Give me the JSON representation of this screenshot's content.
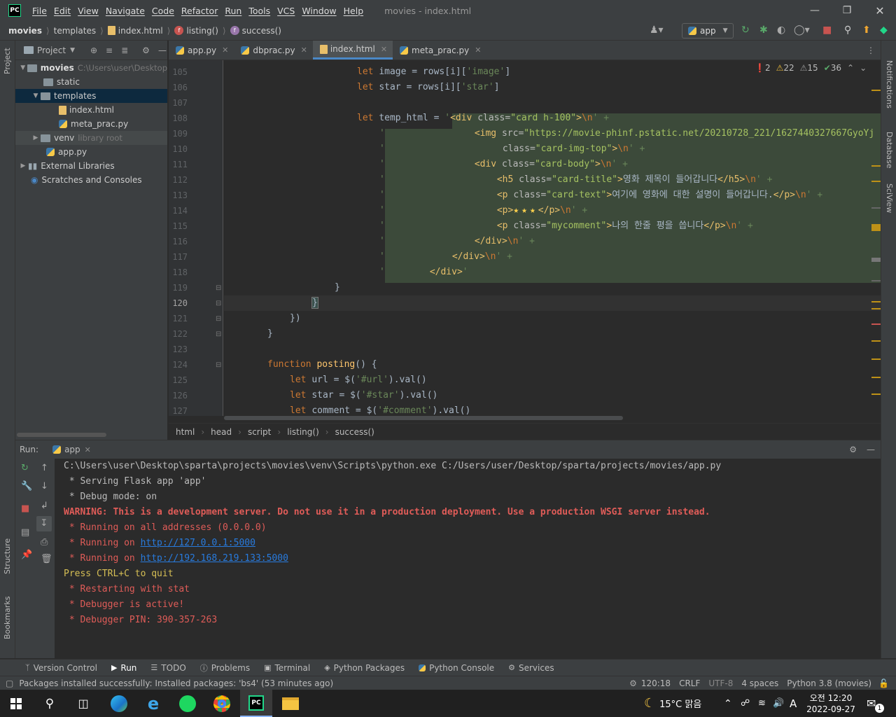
{
  "titlebar": {
    "menu": [
      "File",
      "Edit",
      "View",
      "Navigate",
      "Code",
      "Refactor",
      "Run",
      "Tools",
      "VCS",
      "Window",
      "Help"
    ],
    "title": "movies - index.html"
  },
  "navbar": {
    "crumbs": [
      "movies",
      "templates",
      "index.html",
      "listing()",
      "success()"
    ],
    "run_config": "app"
  },
  "project": {
    "header": "Project",
    "root_name": "movies",
    "root_path": "C:\\Users\\user\\Desktop",
    "static": "static",
    "templates": "templates",
    "index": "index.html",
    "meta": "meta_prac.py",
    "venv": "venv",
    "venv_hint": "library root",
    "app": "app.py",
    "external": "External Libraries",
    "scratches": "Scratches and Consoles"
  },
  "tabs": [
    "app.py",
    "dbprac.py",
    "index.html",
    "meta_prac.py"
  ],
  "inspections": {
    "errors": "2",
    "warnings": "22",
    "weak": "15",
    "typos": "36"
  },
  "code": {
    "lines": [
      "105",
      "106",
      "107",
      "108",
      "109",
      "110",
      "111",
      "112",
      "113",
      "114",
      "115",
      "116",
      "117",
      "118",
      "119",
      "120",
      "121",
      "122",
      "123",
      "124",
      "125",
      "126",
      "127"
    ],
    "current_line": "120",
    "l105a": "let ",
    "l105b": "image",
    "l105c": " = rows[i][",
    "l105d": "'image'",
    "l105e": "]",
    "l106a": "let ",
    "l106b": "star",
    "l106c": " = rows[i][",
    "l106d": "'star'",
    "l106e": "]",
    "l108a": "let ",
    "l108b": "temp_html",
    "l108c": " = ",
    "l108d": "'",
    "l108e": "<div ",
    "l108f": "class=",
    "l108g": "\"card h-100\"",
    "l108h": ">",
    "l108i": "\\n",
    "l108j": "' +",
    "l109a": "'",
    "l109b": "<img ",
    "l109c": "src=",
    "l109d": "\"https://movie-phinf.pstatic.net/20210728_221/1627440327667GyoYj",
    "l110a": "'",
    "l110b": "class=",
    "l110c": "\"card-img-top\"",
    "l110d": ">",
    "l110e": "\\n",
    "l110f": "' +",
    "l111a": "'",
    "l111b": "<div ",
    "l111c": "class=",
    "l111d": "\"card-body\"",
    "l111e": ">",
    "l111f": "\\n",
    "l111g": "' +",
    "l112a": "'",
    "l112b": "<h5 ",
    "l112c": "class=",
    "l112d": "\"card-title\"",
    "l112e": ">",
    "l112f": "영화 제목이 들어갑니다",
    "l112g": "</h5>",
    "l112h": "\\n",
    "l112i": "' +",
    "l113a": "'",
    "l113b": "<p ",
    "l113c": "class=",
    "l113d": "\"card-text\"",
    "l113e": ">",
    "l113f": "여기에 영화에 대한 설명이 들어갑니다.",
    "l113g": "</p>",
    "l113h": "\\n",
    "l113i": "' +",
    "l114a": "'",
    "l114b": "<p>",
    "l114c": "★★★",
    "l114d": "</p>",
    "l114e": "\\n",
    "l114f": "' +",
    "l115a": "'",
    "l115b": "<p ",
    "l115c": "class=",
    "l115d": "\"mycomment\"",
    "l115e": ">",
    "l115f": "나의 한줄 평을 씁니다",
    "l115g": "</p>",
    "l115h": "\\n",
    "l115i": "' +",
    "l116a": "'",
    "l116b": "</div>",
    "l116c": "\\n",
    "l116d": "' +",
    "l117a": "'",
    "l117b": "</div>",
    "l117c": "\\n",
    "l117d": "' +",
    "l118a": "'",
    "l118b": "</div>",
    "l118c": "'",
    "l119": "}",
    "l120": "}",
    "l121": "})",
    "l122": "}",
    "l124a": "function ",
    "l124b": "posting",
    "l124c": "() {",
    "l125a": "let ",
    "l125b": "url",
    "l125c": " = $(",
    "l125d": "'#url'",
    "l125e": ").val()",
    "l126a": "let ",
    "l126b": "star",
    "l126c": " = $(",
    "l126d": "'#star'",
    "l126e": ").val()",
    "l127a": "let ",
    "l127b": "comment",
    "l127c": " = $(",
    "l127d": "'#comment'",
    "l127e": ").val()"
  },
  "breadcrumb": [
    "html",
    "head",
    "script",
    "listing()",
    "success()"
  ],
  "run": {
    "label": "Run:",
    "tab": "app",
    "lines": [
      "C:\\Users\\user\\Desktop\\sparta\\projects\\movies\\venv\\Scripts\\python.exe C:/Users/user/Desktop/sparta/projects/movies/app.py",
      " * Serving Flask app 'app'",
      " * Debug mode: on",
      "WARNING: This is a development server. Do not use it in a production deployment. Use a production WSGI server instead.",
      " * Running on all addresses (0.0.0.0)",
      " * Running on ",
      "http://127.0.0.1:5000",
      " * Running on ",
      "http://192.168.219.133:5000",
      "Press CTRL+C to quit",
      " * Restarting with stat",
      " * Debugger is active!",
      " * Debugger PIN: 390-357-263"
    ]
  },
  "side": {
    "project": "Project",
    "structure": "Structure",
    "bookmarks": "Bookmarks",
    "notifications": "Notifications",
    "database": "Database",
    "sciview": "SciView"
  },
  "bottom_tabs": [
    "Version Control",
    "Run",
    "TODO",
    "Problems",
    "Terminal",
    "Python Packages",
    "Python Console",
    "Services"
  ],
  "status": {
    "message": "Packages installed successfully: Installed packages: 'bs4' (53 minutes ago)",
    "position": "120:18",
    "line_sep": "CRLF",
    "encoding": "UTF-8",
    "indent": "4 spaces",
    "interpreter": "Python 3.8 (movies)"
  },
  "taskbar": {
    "weather": "15°C 맑음",
    "ime": "A",
    "time": "오전 12:20",
    "date": "2022-09-27",
    "notif_count": "1"
  }
}
